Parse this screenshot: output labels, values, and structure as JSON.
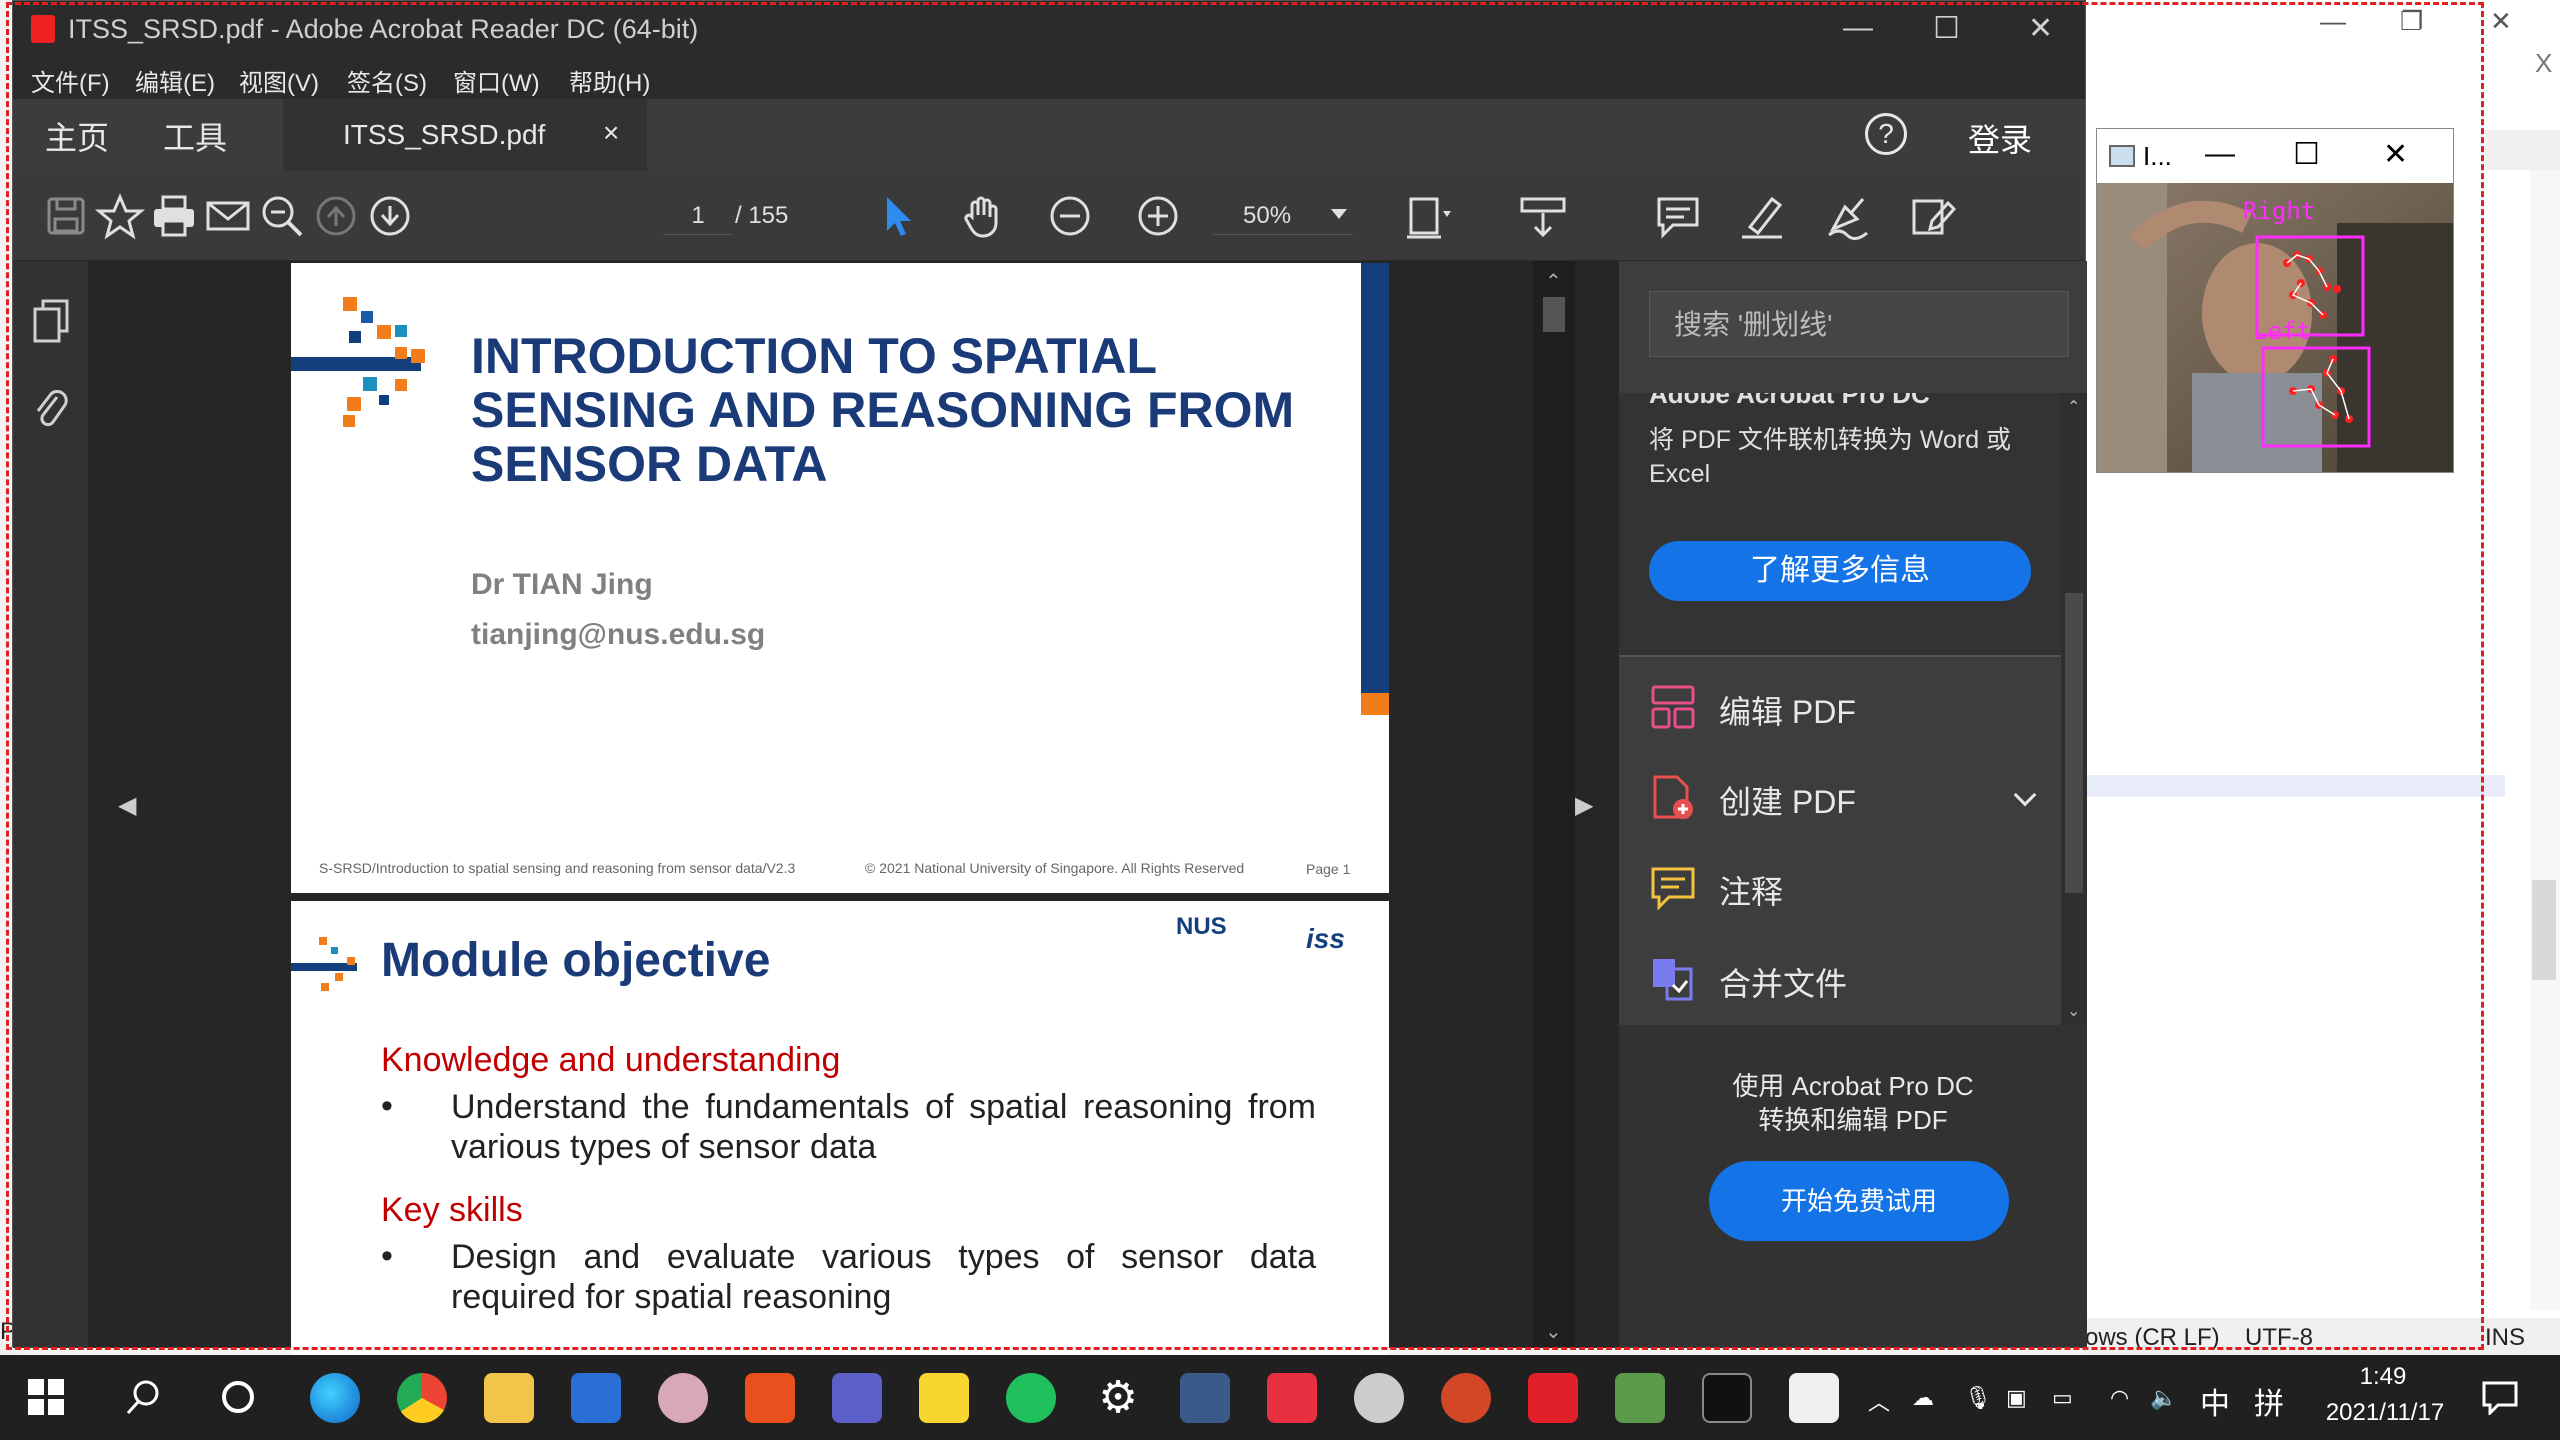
{
  "window": {
    "title": "ITSS_SRSD.pdf - Adobe Acrobat Reader DC (64-bit)"
  },
  "menu": [
    "文件(F)",
    "编辑(E)",
    "视图(V)",
    "签名(S)",
    "窗口(W)",
    "帮助(H)"
  ],
  "tabs": {
    "home": "主页",
    "tools": "工具",
    "document": "ITSS_SRSD.pdf",
    "close": "×",
    "help": "?",
    "login": "登录"
  },
  "toolbar": {
    "page_current": "1",
    "page_total": "/ 155",
    "zoom": "50%"
  },
  "page1": {
    "title": "INTRODUCTION TO SPATIAL SENSING AND REASONING FROM SENSOR DATA",
    "author": "Dr TIAN Jing",
    "email": "tianjing@nus.edu.sg",
    "footer": "S-SRSD/Introduction to spatial sensing and reasoning from sensor data/V2.3",
    "copyright": "© 2021 National University of Singapore. All Rights Reserved",
    "page_label": "Page 1"
  },
  "page2": {
    "title": "Module objective",
    "logo_nus": "NUS",
    "logo_iss": "iss",
    "section1": "Knowledge and understanding",
    "bullet1": "Understand the fundamentals of spatial reasoning from various types of sensor data",
    "section2": "Key skills",
    "bullet2": "Design and evaluate various types of sensor data required for spatial reasoning",
    "bullet_symbol": "•"
  },
  "right_pane": {
    "search_placeholder": "搜索 '删划线'",
    "promo_heading": "Adobe Acrobat Pro DC",
    "promo_desc": "将 PDF 文件联机转换为 Word 或 Excel",
    "learn_more": "了解更多信息",
    "tools": [
      {
        "label": "编辑 PDF",
        "icon": "edit-pdf-icon",
        "color": "#e8508a"
      },
      {
        "label": "创建 PDF",
        "icon": "create-pdf-icon",
        "color": "#e85050"
      },
      {
        "label": "注释",
        "icon": "comment-icon",
        "color": "#f5c242"
      },
      {
        "label": "合并文件",
        "icon": "combine-files-icon",
        "color": "#7b7bf0"
      }
    ],
    "pro_text_1": "使用 Acrobat Pro DC",
    "pro_text_2": "转换和编辑 PDF",
    "trial_button": "开始免费试用"
  },
  "camera_window": {
    "title": "I...",
    "label_right": "Right",
    "label_left": "Left"
  },
  "background_window": {
    "status_eol": "ows (CR LF)",
    "status_encoding": "UTF-8",
    "status_ins": "INS",
    "close_glyph": "X",
    "left_status": "P"
  },
  "taskbar": {
    "time": "1:49",
    "date": "2021/11/17",
    "ime_lang": "中",
    "ime_mode": "拼"
  },
  "colors": {
    "acrobat_dark": "#323232",
    "accent_blue": "#1473e6",
    "nus_blue": "#1a3a78",
    "nus_orange": "#f07d1a",
    "heading_red": "#c00000"
  }
}
